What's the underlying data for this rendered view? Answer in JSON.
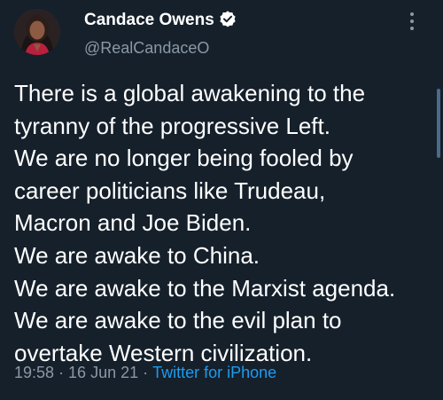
{
  "author": {
    "name": "Candace Owens",
    "handle": "@RealCandaceO",
    "verified": true
  },
  "tweet": {
    "lines": [
      "There is a global awakening to the",
      "tyranny of the progressive Left.",
      "We are no longer being fooled by",
      "career politicians like Trudeau,",
      "Macron and Joe Biden.",
      "We are awake to China.",
      "We are awake to the Marxist agenda.",
      "We are awake to the evil plan to",
      "overtake Western civilization."
    ]
  },
  "meta": {
    "time": "19:58",
    "date": "16 Jun 21",
    "source": "Twitter for iPhone",
    "separator": "·"
  },
  "icons": {
    "verified": "verified-badge-icon",
    "more": "more-vertical-icon"
  },
  "colors": {
    "background": "#15202b",
    "text": "#ffffff",
    "secondary": "#8b98a5",
    "accent": "#1d9bf0"
  }
}
